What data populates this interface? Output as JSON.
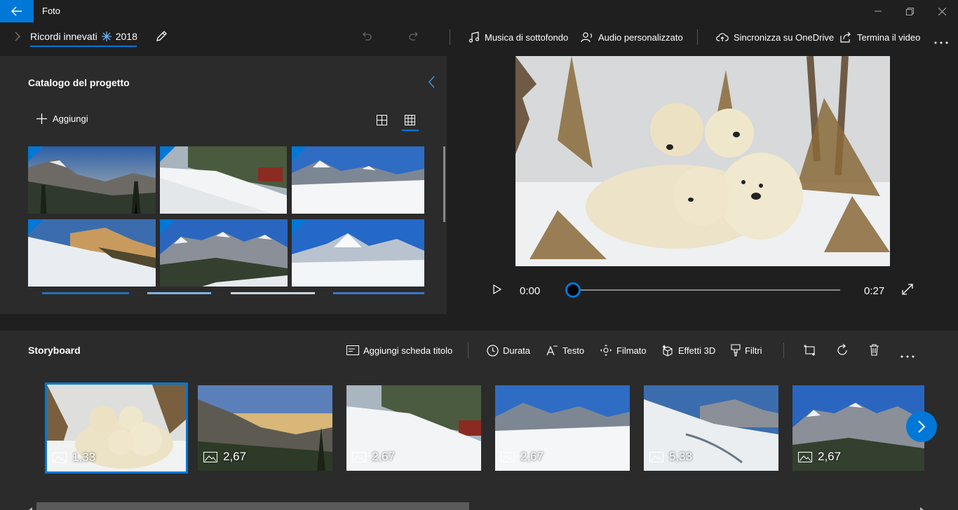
{
  "window": {
    "title": "Foto"
  },
  "project": {
    "name": "Ricordi innevati",
    "year": "2018"
  },
  "commands": {
    "music": "Musica di sottofondo",
    "custom_audio": "Audio personalizzato",
    "sync": "Sincronizza su OneDrive",
    "finish": "Termina il video"
  },
  "library": {
    "title": "Catalogo del progetto",
    "add_label": "Aggiungi"
  },
  "player": {
    "current_time": "0:00",
    "total_time": "0:27",
    "progress": 0
  },
  "storyboard": {
    "title": "Storyboard",
    "tools": {
      "title_card": "Aggiungi scheda titolo",
      "duration": "Durata",
      "text": "Testo",
      "motion": "Filmato",
      "effects3d": "Effetti 3D",
      "filters": "Filtri"
    },
    "clips": [
      {
        "duration": "1,33"
      },
      {
        "duration": "2,67"
      },
      {
        "duration": "2,67"
      },
      {
        "duration": "2,67"
      },
      {
        "duration": "5,33"
      },
      {
        "duration": "2,67"
      }
    ]
  },
  "colors": {
    "accent": "#0078d7",
    "background": "#1f1f1f",
    "panel": "#2b2b2b"
  }
}
